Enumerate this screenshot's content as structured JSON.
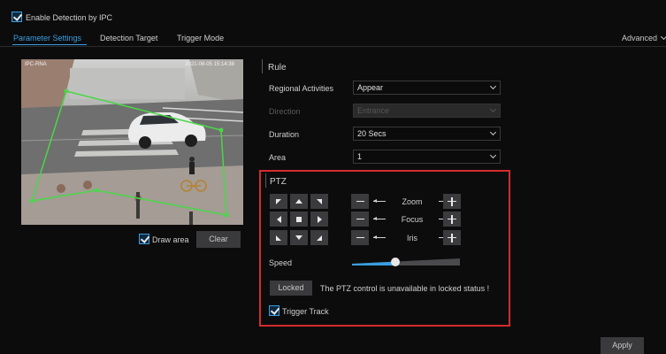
{
  "header": {
    "enable_detection_label": "Enable Detection by IPC",
    "enable_detection_checked": true
  },
  "tabs": [
    {
      "label": "Parameter Settings",
      "active": true
    },
    {
      "label": "Detection Target",
      "active": false
    },
    {
      "label": "Trigger Mode",
      "active": false
    }
  ],
  "advanced_label": "Advanced",
  "video": {
    "osd_camera": "IPC-RNA",
    "osd_time": "2021-08-05 15:14:38",
    "draw_area_label": "Draw area",
    "draw_area_checked": true,
    "clear_label": "Clear"
  },
  "rule": {
    "heading": "Rule",
    "regional_activities_label": "Regional Activities",
    "regional_activities_value": "Appear",
    "direction_label": "Direction",
    "direction_value": "Entrance",
    "duration_label": "Duration",
    "duration_value": "20 Secs",
    "area_label": "Area",
    "area_value": "1"
  },
  "ptz": {
    "heading": "PTZ",
    "zoom_label": "Zoom",
    "focus_label": "Focus",
    "iris_label": "Iris",
    "speed_label": "Speed",
    "speed_level": 0.4,
    "locked_label": "Locked",
    "locked_message": "The PTZ control is unavailable in locked status !",
    "trigger_track_label": "Trigger Track",
    "trigger_track_checked": true
  },
  "footer": {
    "apply_label": "Apply"
  },
  "colors": {
    "accent": "#3a9de0",
    "highlight_border": "#d42b2b",
    "zone_line": "#4cd64a",
    "background": "#0c0c0d"
  }
}
